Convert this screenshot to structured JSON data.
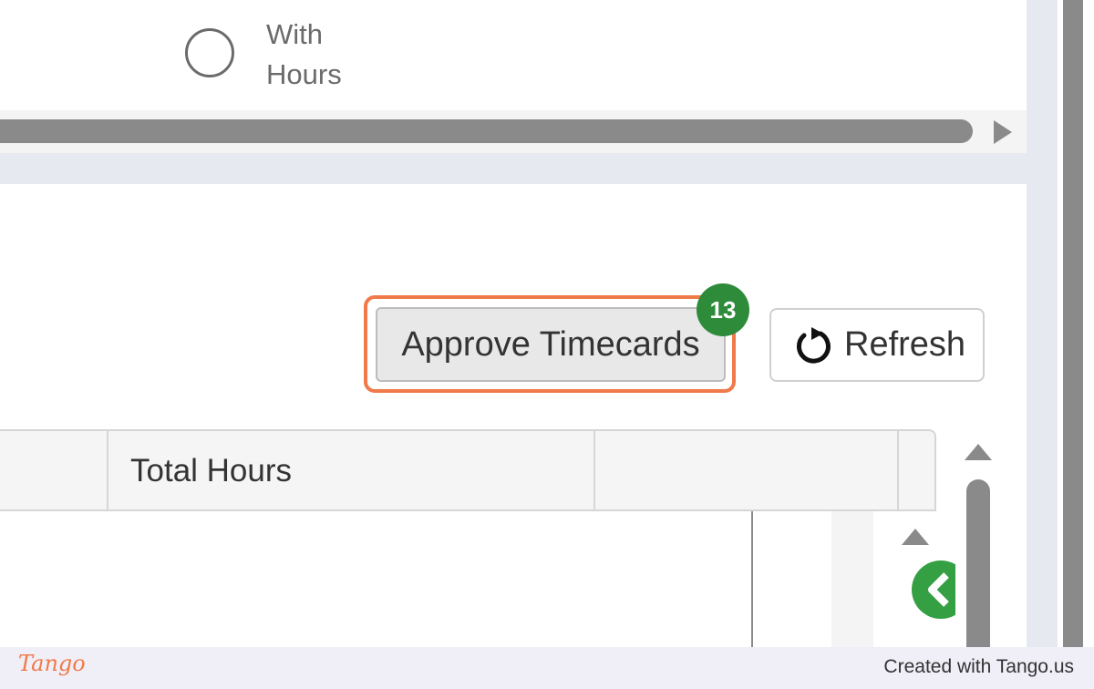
{
  "filter": {
    "radio_label": "With Hours"
  },
  "toolbar": {
    "approve_label": "Approve Timecards",
    "approve_badge_count": "13",
    "refresh_label": "Refresh"
  },
  "grid": {
    "columns": [
      "",
      "Total Hours",
      ""
    ]
  },
  "footer": {
    "logo_text": "Tango",
    "credit_text": "Created with Tango.us"
  },
  "colors": {
    "highlight": "#f07a4a",
    "badge": "#2e8b3a",
    "collapse_button": "#34a043",
    "scrollbar": "#8a8a8a"
  },
  "icons": [
    "radio-button-icon",
    "refresh-icon",
    "chevron-left-icon",
    "scroll-up-arrow-icon",
    "scroll-right-arrow-icon"
  ]
}
